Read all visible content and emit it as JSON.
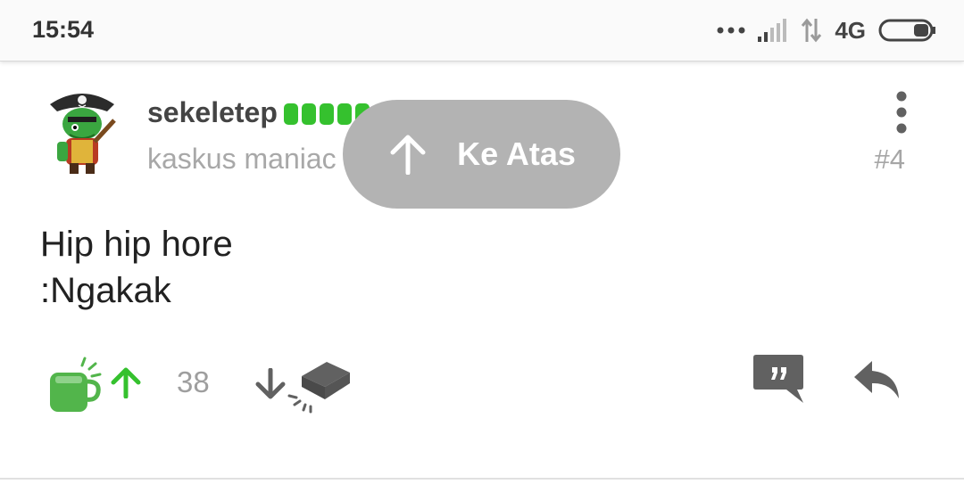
{
  "status_bar": {
    "time": "15:54",
    "network": "4G",
    "icons": [
      "more-dots-icon",
      "signal-icon",
      "data-transfer-icon",
      "battery-icon"
    ]
  },
  "post": {
    "username": "sekeletep",
    "user_title": "kaskus maniac",
    "post_number": "#4",
    "reputation_bars": 5,
    "content_lines": [
      "Hip hip hore",
      ":Ngakak"
    ],
    "cendol_count": "38"
  },
  "scroll_top_toast": {
    "label": "Ke Atas"
  },
  "colors": {
    "reputation": "#35c12e",
    "cendol": "#52b54b",
    "toast_bg": "#b3b3b3",
    "icon_gray": "#616161"
  }
}
